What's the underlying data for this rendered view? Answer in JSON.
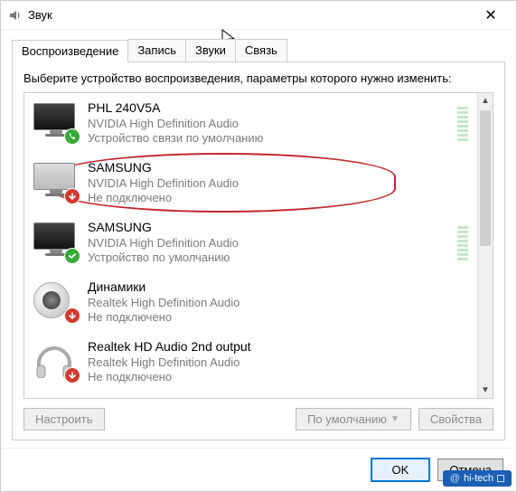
{
  "window": {
    "title": "Звук",
    "close_glyph": "✕"
  },
  "tabs": {
    "playback": "Воспроизведение",
    "recording": "Запись",
    "sounds": "Звуки",
    "communications": "Связь"
  },
  "instruction": "Выберите устройство воспроизведения, параметры которого нужно изменить:",
  "devices": [
    {
      "name": "PHL 240V5A",
      "driver": "NVIDIA High Definition Audio",
      "status": "Устройство связи по умолчанию"
    },
    {
      "name": "SAMSUNG",
      "driver": "NVIDIA High Definition Audio",
      "status": "Не подключено"
    },
    {
      "name": "SAMSUNG",
      "driver": "NVIDIA High Definition Audio",
      "status": "Устройство по умолчанию"
    },
    {
      "name": "Динамики",
      "driver": "Realtek High Definition Audio",
      "status": "Не подключено"
    },
    {
      "name": "Realtek HD Audio 2nd output",
      "driver": "Realtek High Definition Audio",
      "status": "Не подключено"
    }
  ],
  "buttons": {
    "configure": "Настроить",
    "default": "По умолчанию",
    "properties": "Свойства",
    "ok": "OK",
    "cancel": "Отмена"
  },
  "watermark": "hi-tech"
}
